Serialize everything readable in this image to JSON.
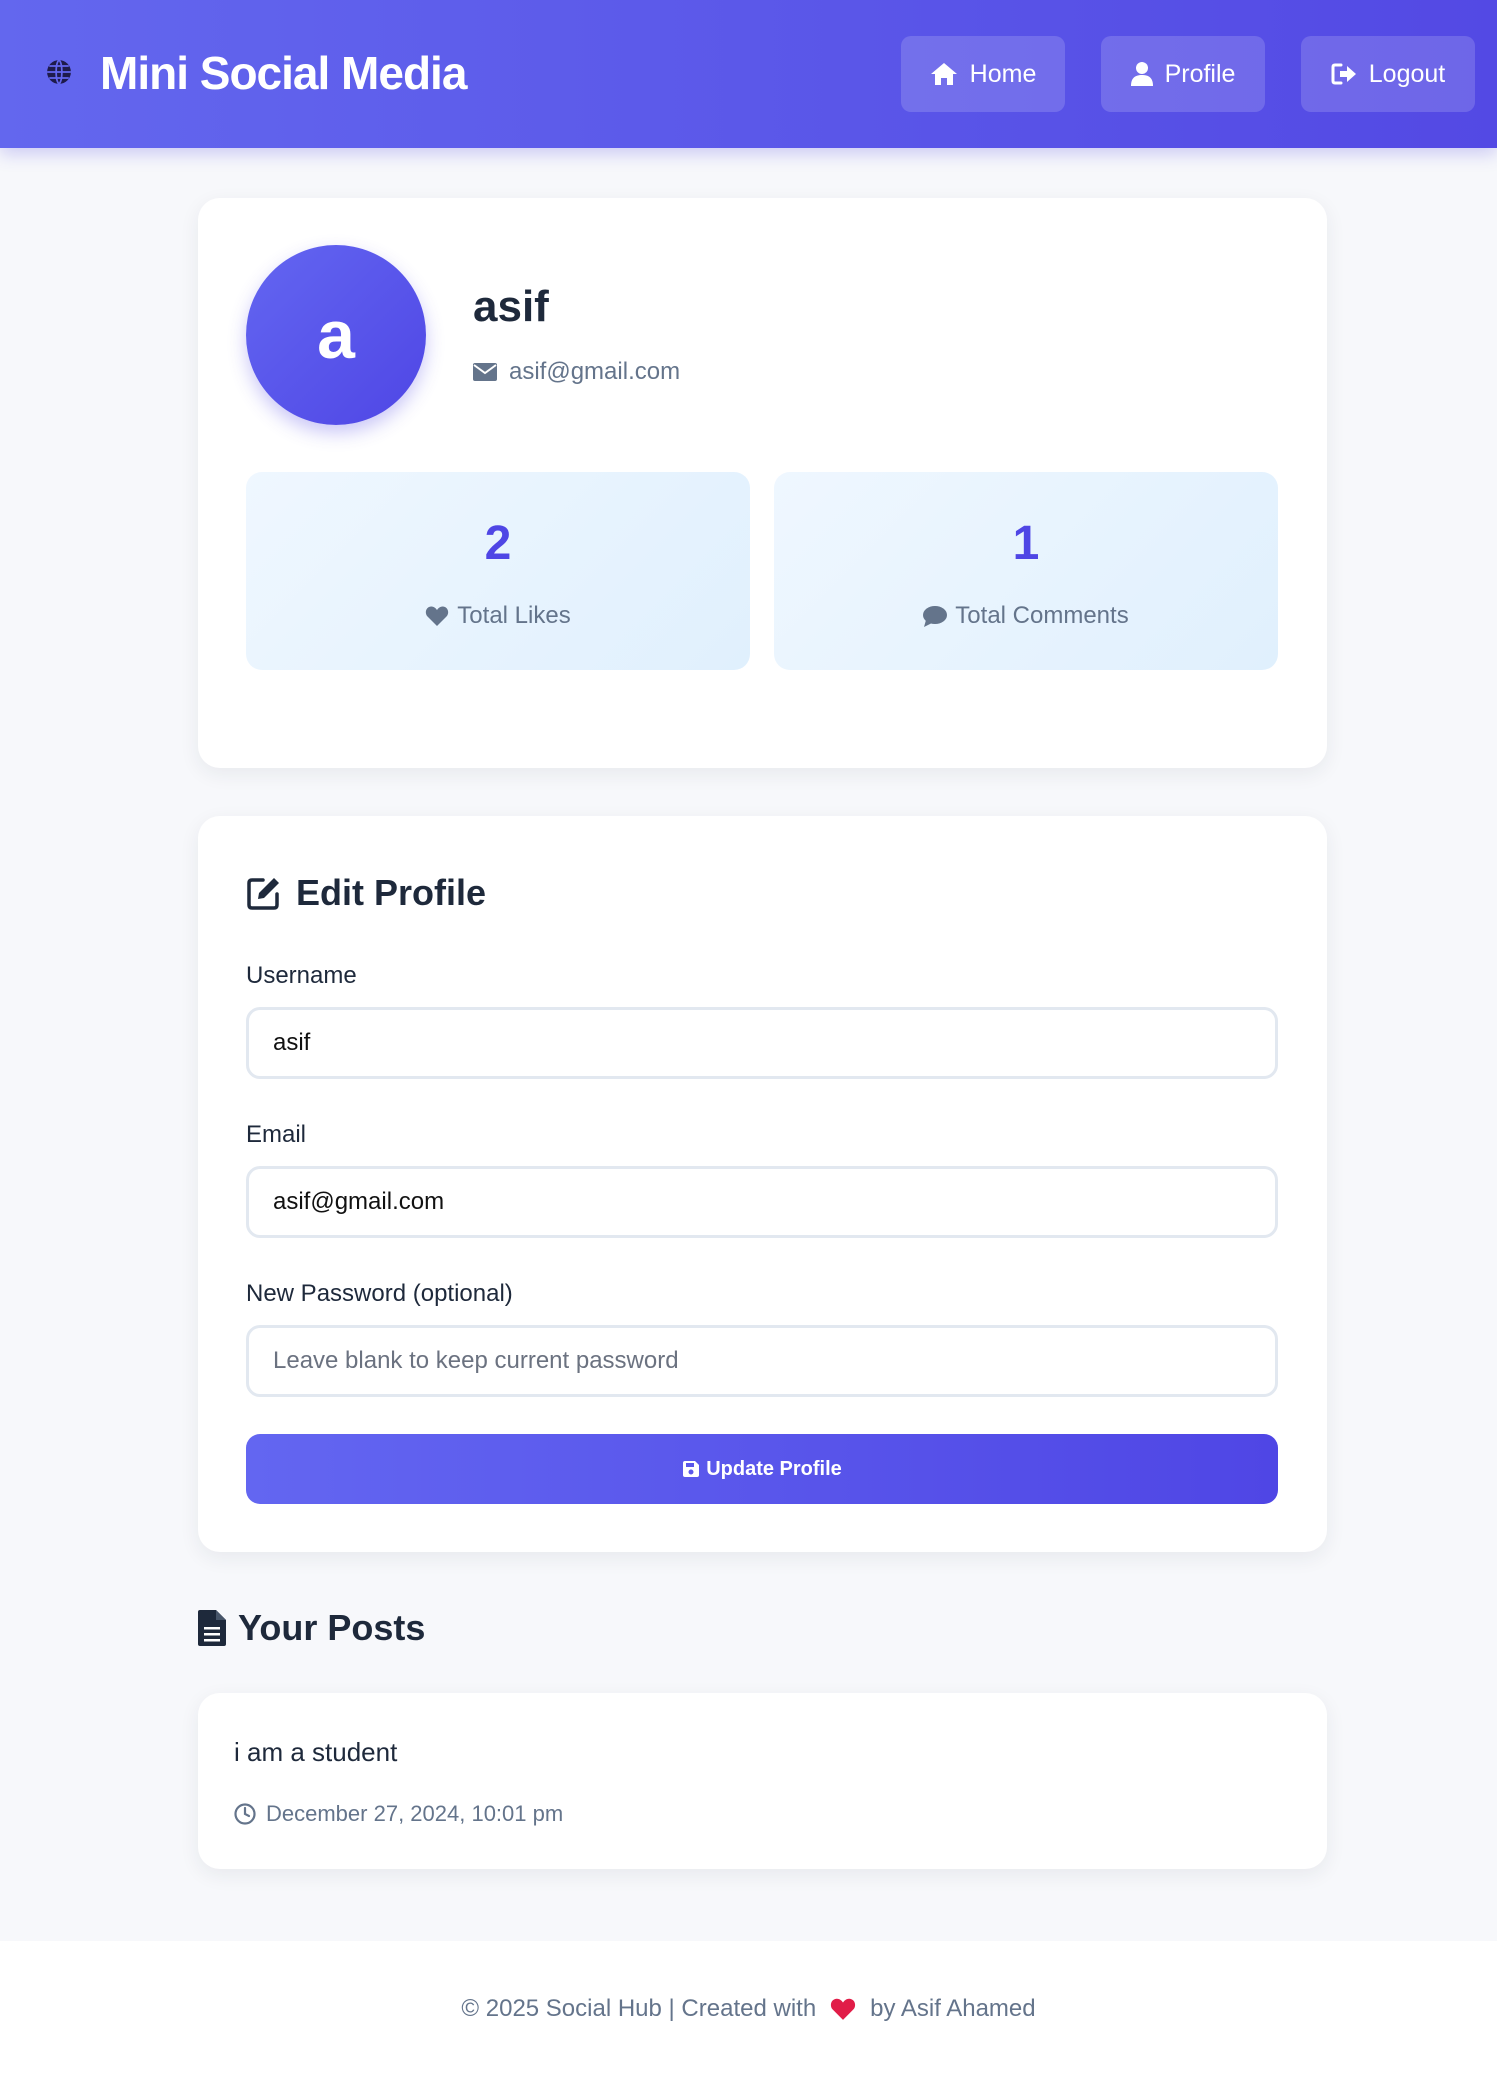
{
  "header": {
    "title": "Mini Social Media",
    "brand_icon": "globe-icon",
    "nav": {
      "home": "Home",
      "profile": "Profile",
      "logout": "Logout"
    }
  },
  "profile": {
    "avatar_letter": "a",
    "username": "asif",
    "email": "asif@gmail.com",
    "stats": {
      "likes_value": "2",
      "likes_label": "Total Likes",
      "comments_value": "1",
      "comments_label": "Total Comments"
    }
  },
  "edit_profile": {
    "title": "Edit Profile",
    "username_label": "Username",
    "username_value": "asif",
    "email_label": "Email",
    "email_value": "asif@gmail.com",
    "password_label": "New Password (optional)",
    "password_placeholder": "Leave blank to keep current password",
    "submit_label": "Update Profile"
  },
  "posts": {
    "title": "Your Posts",
    "items": [
      {
        "content": "i am a student",
        "timestamp": "December 27, 2024, 10:01 pm"
      }
    ]
  },
  "footer": {
    "left": "© 2025 Social Hub | Created with",
    "right": "by Asif Ahamed"
  },
  "colors": {
    "accent": "#4f46e5",
    "header_start": "#6367ee",
    "heart": "#e11d48"
  }
}
